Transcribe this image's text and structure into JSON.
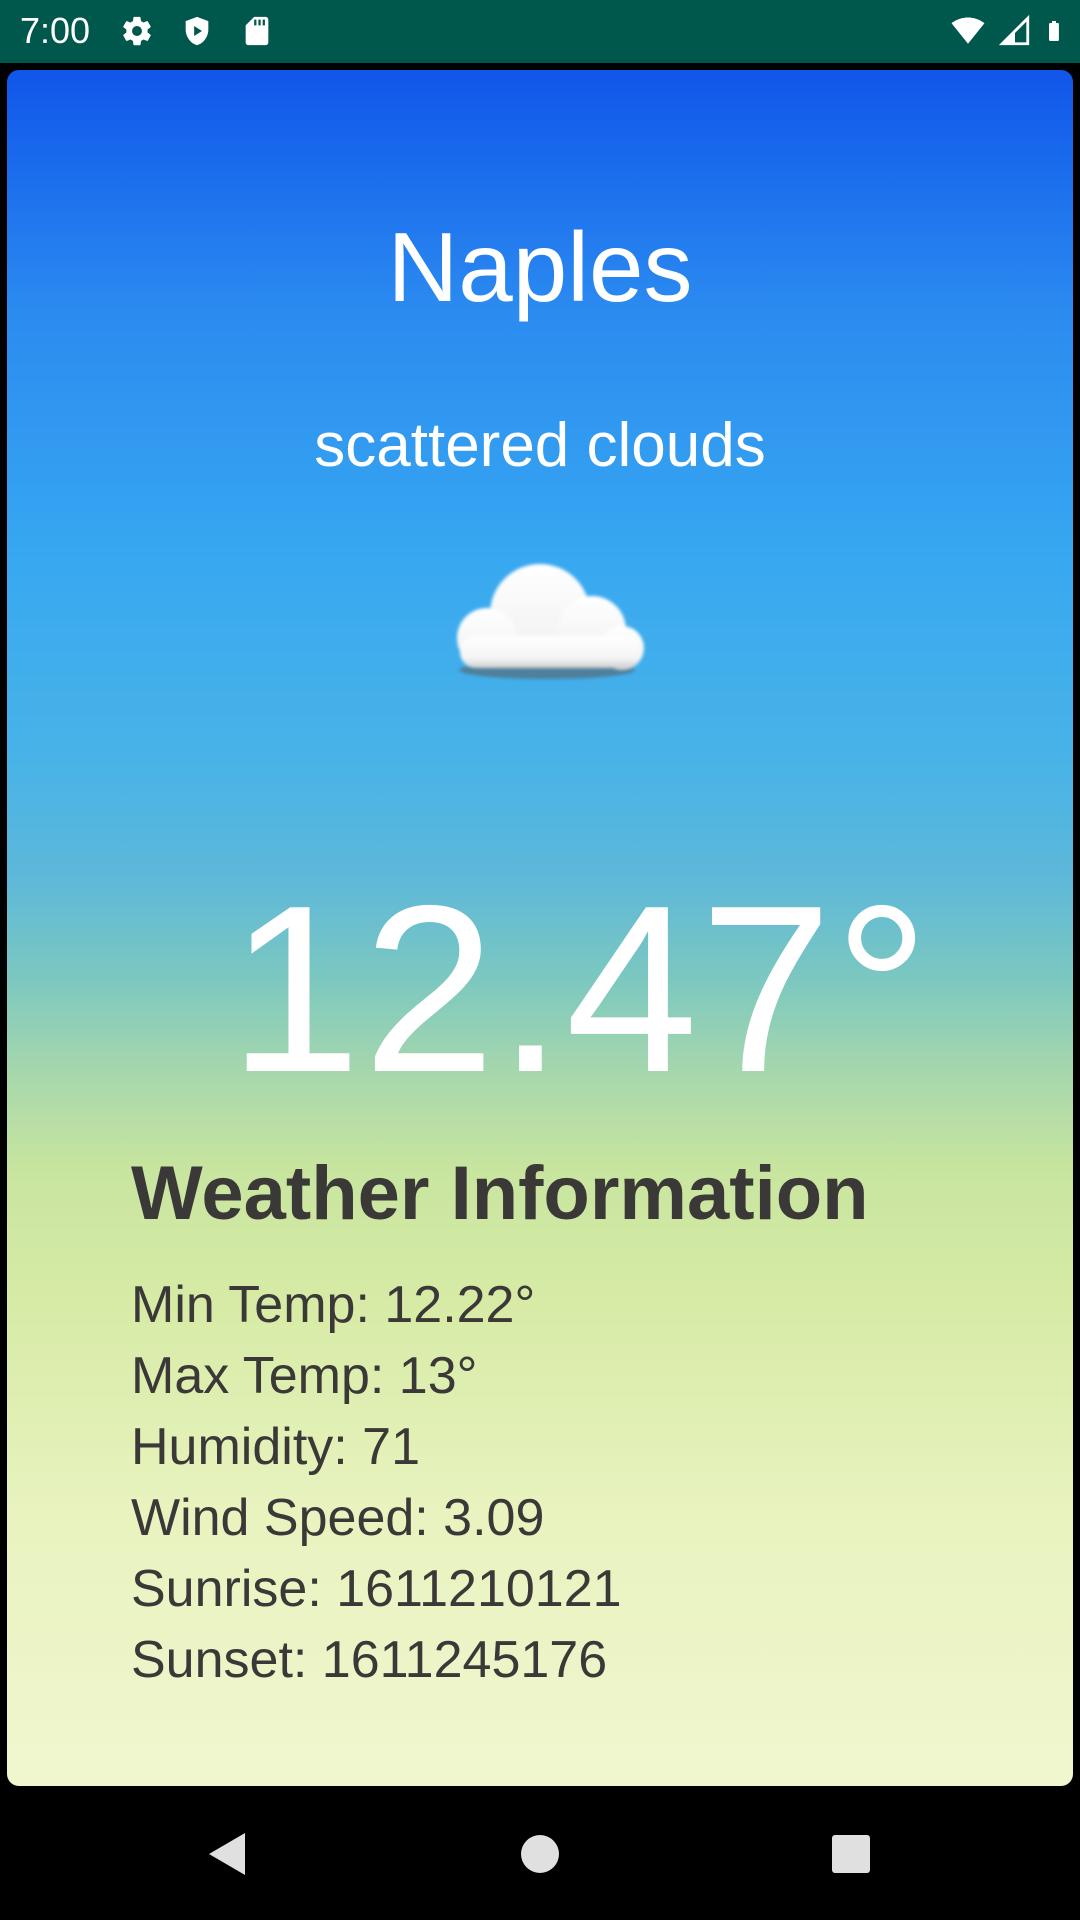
{
  "status_bar": {
    "time": "7:00",
    "left_icons": [
      "gear-icon",
      "shield-play-icon",
      "sd-card-icon"
    ],
    "right_icons": [
      "wifi-icon",
      "cellular-signal-icon",
      "battery-icon"
    ],
    "background_color": "#00574b"
  },
  "weather": {
    "city": "Naples",
    "description": "scattered clouds",
    "icon": "cloud-icon",
    "temperature": "12.47°"
  },
  "info": {
    "heading": "Weather Information",
    "min_temp": "Min Temp: 12.22°",
    "max_temp": "Max Temp: 13°",
    "humidity": "Humidity: 71",
    "wind_speed": "Wind Speed: 3.09",
    "sunrise": "Sunrise: 1611210121",
    "sunset": "Sunset: 1611245176"
  },
  "nav_bar": {
    "buttons": [
      "back-icon",
      "home-icon",
      "recents-icon"
    ]
  },
  "colors": {
    "gradient_top": "#1056ea",
    "gradient_bottom": "#f1f6cf",
    "text_dark": "#3b3838",
    "text_light": "#ffffff"
  }
}
